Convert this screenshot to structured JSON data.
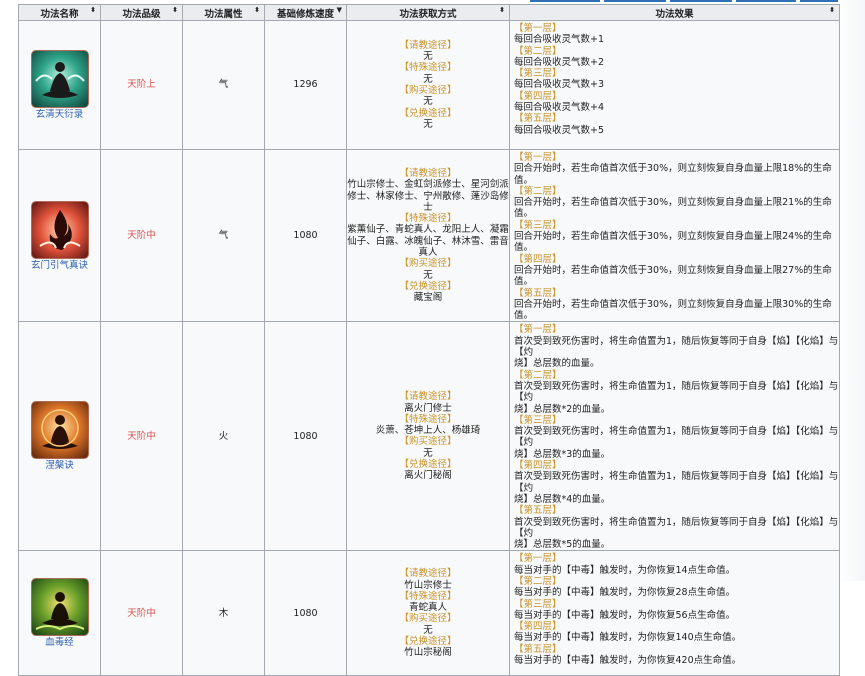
{
  "headers": {
    "name": "功法名称",
    "grade": "功法品级",
    "attr": "功法属性",
    "speed": "基础修炼速度",
    "source": "功法获取方式",
    "effect": "功法效果"
  },
  "labels": {
    "qingjiao": "【请教途径】",
    "teshu": "【特殊途径】",
    "goumai": "【购买途径】",
    "duihuan": "【兑换途径】",
    "l1": "【第一层】",
    "l2": "【第二层】",
    "l3": "【第三层】",
    "l4": "【第四层】",
    "l5": "【第五层】"
  },
  "icons": [
    "meditation-teal-icon",
    "flame-red-icon",
    "fire-meditation-icon",
    "poison-meditation-icon"
  ],
  "rows": [
    {
      "name": "玄清天衍录",
      "grade": "天阶上",
      "attr": "气",
      "speed": "1296",
      "src": {
        "qingjiao": "无",
        "teshu": "无",
        "goumai": "无",
        "duihuan": "无"
      },
      "effects": [
        "每回合吸收灵气数+1",
        "每回合吸收灵气数+2",
        "每回合吸收灵气数+3",
        "每回合吸收灵气数+4",
        "每回合吸收灵气数+5"
      ]
    },
    {
      "name": "玄门引气真诀",
      "grade": "天阶中",
      "attr": "气",
      "speed": "1080",
      "src": {
        "qingjiao": "竹山宗修士、金虹剑派修士、星河剑派修士、林家修士、宁州散修、蓬沙岛修士",
        "teshu": "紫薰仙子、青蛇真人、龙阳上人、凝霜仙子、白露、冰魄仙子、林沐雪、雷音真人",
        "goumai": "无",
        "duihuan": "藏宝阁"
      },
      "effects": [
        "回合开始时，若生命值首次低于30%，则立刻恢复自身血量上限18%的生命值。",
        "回合开始时，若生命值首次低于30%，则立刻恢复自身血量上限21%的生命值。",
        "回合开始时，若生命值首次低于30%，则立刻恢复自身血量上限24%的生命值。",
        "回合开始时，若生命值首次低于30%，则立刻恢复自身血量上限27%的生命值。",
        "回合开始时，若生命值首次低于30%，则立刻恢复自身血量上限30%的生命值。"
      ]
    },
    {
      "name": "涅槃诀",
      "grade": "天阶中",
      "attr": "火",
      "speed": "1080",
      "src": {
        "qingjiao": "离火门修士",
        "teshu": "炎萧、苍坤上人、杨雄琦",
        "goumai": "无",
        "duihuan": "离火门秘阁"
      },
      "effects": [
        [
          "首次受到致死伤害时，将生命值置为1，随后恢复等同于自身【焰】【化焰】与【灼",
          "烧】总层数的血量。"
        ],
        [
          "首次受到致死伤害时，将生命值置为1，随后恢复等同于自身【焰】【化焰】与【灼",
          "烧】总层数*2的血量。"
        ],
        [
          "首次受到致死伤害时，将生命值置为1，随后恢复等同于自身【焰】【化焰】与【灼",
          "烧】总层数*3的血量。"
        ],
        [
          "首次受到致死伤害时，将生命值置为1，随后恢复等同于自身【焰】【化焰】与【灼",
          "烧】总层数*4的血量。"
        ],
        [
          "首次受到致死伤害时，将生命值置为1，随后恢复等同于自身【焰】【化焰】与【灼",
          "烧】总层数*5的血量。"
        ]
      ]
    },
    {
      "name": "血毒经",
      "grade": "天阶中",
      "attr": "木",
      "speed": "1080",
      "src": {
        "qingjiao": "竹山宗修士",
        "teshu": "青蛇真人",
        "goumai": "无",
        "duihuan": "竹山宗秘阁"
      },
      "effects": [
        "每当对手的【中毒】触发时，为你恢复14点生命值。",
        "每当对手的【中毒】触发时，为你恢复28点生命值。",
        "每当对手的【中毒】触发时，为你恢复56点生命值。",
        "每当对手的【中毒】触发时，为你恢复140点生命值。",
        "每当对手的【中毒】触发时，为你恢复420点生命值。"
      ]
    }
  ]
}
